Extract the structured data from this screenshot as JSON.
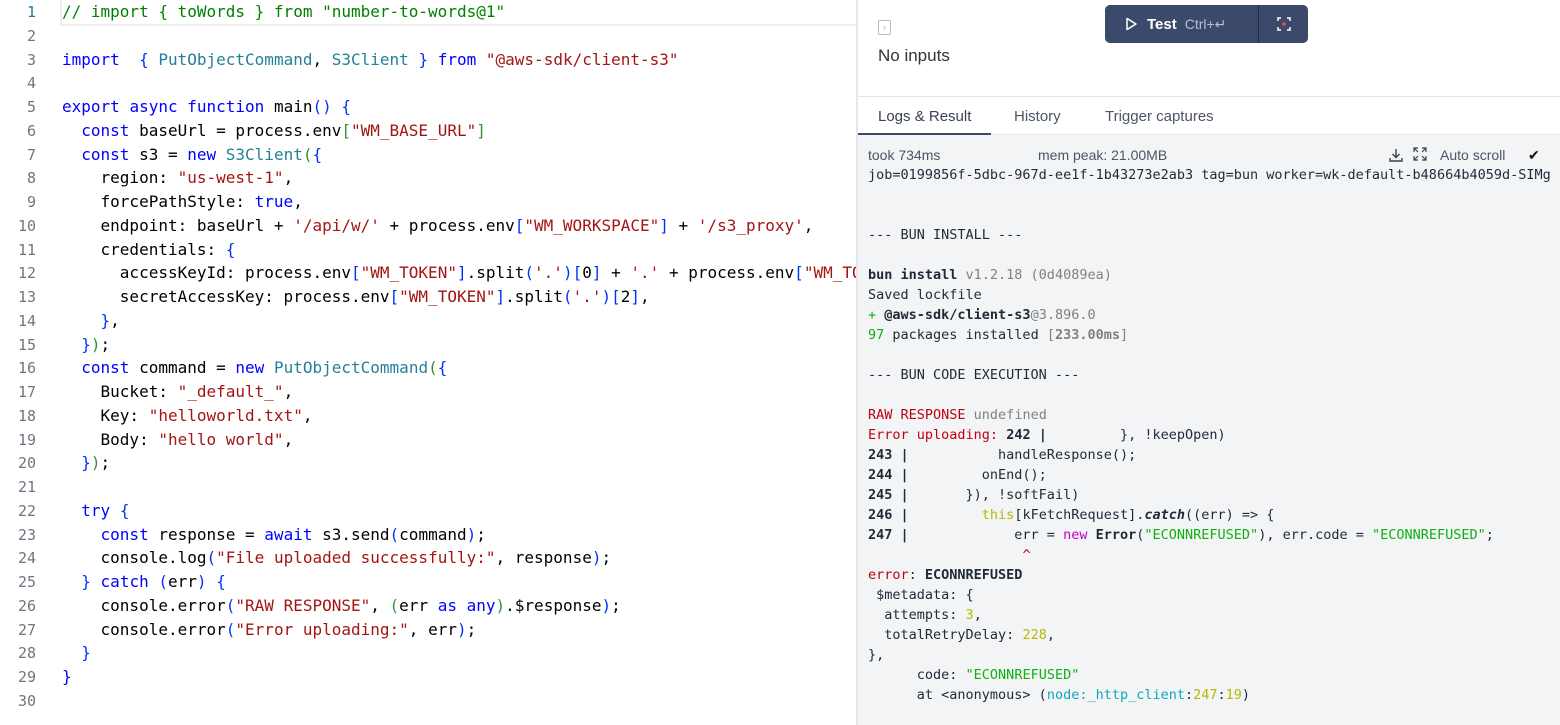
{
  "editor": {
    "lines": [
      [
        [
          "c",
          "// import { toWords } from \"number-to-words@1\""
        ]
      ],
      [],
      [
        [
          "k",
          "import"
        ],
        [
          "",
          "  "
        ],
        [
          "br",
          "{"
        ],
        [
          "",
          " "
        ],
        [
          "t",
          "PutObjectCommand"
        ],
        [
          "",
          ", "
        ],
        [
          "t",
          "S3Client"
        ],
        [
          "",
          " "
        ],
        [
          "br",
          "}"
        ],
        [
          "",
          " "
        ],
        [
          "k",
          "from"
        ],
        [
          "",
          " "
        ],
        [
          "s",
          "\"@aws-sdk/client-s3\""
        ]
      ],
      [],
      [
        [
          "k",
          "export"
        ],
        [
          "",
          " "
        ],
        [
          "k",
          "async"
        ],
        [
          "",
          " "
        ],
        [
          "k",
          "function"
        ],
        [
          "",
          " main"
        ],
        [
          "br",
          "()"
        ],
        [
          "",
          " "
        ],
        [
          "br",
          "{"
        ]
      ],
      [
        [
          "",
          "  "
        ],
        [
          "k",
          "const"
        ],
        [
          "",
          " baseUrl = process.env"
        ],
        [
          "b2",
          "["
        ],
        [
          "s",
          "\"WM_BASE_URL\""
        ],
        [
          "b2",
          "]"
        ]
      ],
      [
        [
          "",
          "  "
        ],
        [
          "k",
          "const"
        ],
        [
          "",
          " s3 = "
        ],
        [
          "k",
          "new"
        ],
        [
          "",
          " "
        ],
        [
          "t",
          "S3Client"
        ],
        [
          "b2",
          "("
        ],
        [
          "br",
          "{"
        ]
      ],
      [
        [
          "",
          "    region: "
        ],
        [
          "s",
          "\"us-west-1\""
        ],
        [
          "",
          ","
        ]
      ],
      [
        [
          "",
          "    forcePathStyle: "
        ],
        [
          "k",
          "true"
        ],
        [
          "",
          ","
        ]
      ],
      [
        [
          "",
          "    endpoint: baseUrl + "
        ],
        [
          "s",
          "'/api/w/'"
        ],
        [
          "",
          " + process.env"
        ],
        [
          "br",
          "["
        ],
        [
          "s",
          "\"WM_WORKSPACE\""
        ],
        [
          "br",
          "]"
        ],
        [
          "",
          " + "
        ],
        [
          "s",
          "'/s3_proxy'"
        ],
        [
          "",
          ","
        ]
      ],
      [
        [
          "",
          "    credentials: "
        ],
        [
          "br",
          "{"
        ]
      ],
      [
        [
          "",
          "      accessKeyId: process.env"
        ],
        [
          "br",
          "["
        ],
        [
          "s",
          "\"WM_TOKEN\""
        ],
        [
          "br",
          "]"
        ],
        [
          "",
          ".split"
        ],
        [
          "br",
          "("
        ],
        [
          "s",
          "'.'"
        ],
        [
          "br",
          ")"
        ],
        [
          "br",
          "["
        ],
        [
          "",
          "0"
        ],
        [
          "br",
          "]"
        ],
        [
          "",
          " + "
        ],
        [
          "s",
          "'.'"
        ],
        [
          "",
          " + process.env"
        ],
        [
          "br",
          "["
        ],
        [
          "s",
          "\"WM_TOKEN\""
        ],
        [
          "br",
          "]"
        ]
      ],
      [
        [
          "",
          "      secretAccessKey: process.env"
        ],
        [
          "br",
          "["
        ],
        [
          "s",
          "\"WM_TOKEN\""
        ],
        [
          "br",
          "]"
        ],
        [
          "",
          ".split"
        ],
        [
          "br",
          "("
        ],
        [
          "s",
          "'.'"
        ],
        [
          "br",
          ")"
        ],
        [
          "br",
          "["
        ],
        [
          "",
          "2"
        ],
        [
          "br",
          "]"
        ],
        [
          "",
          ","
        ]
      ],
      [
        [
          "",
          "    "
        ],
        [
          "br",
          "}"
        ],
        [
          "",
          ","
        ]
      ],
      [
        [
          "",
          "  "
        ],
        [
          "br",
          "}"
        ],
        [
          "b2",
          ")"
        ],
        [
          "",
          ";"
        ]
      ],
      [
        [
          "",
          "  "
        ],
        [
          "k",
          "const"
        ],
        [
          "",
          " command = "
        ],
        [
          "k",
          "new"
        ],
        [
          "",
          " "
        ],
        [
          "t",
          "PutObjectCommand"
        ],
        [
          "b2",
          "("
        ],
        [
          "br",
          "{"
        ]
      ],
      [
        [
          "",
          "    Bucket: "
        ],
        [
          "s",
          "\"_default_\""
        ],
        [
          "",
          ","
        ]
      ],
      [
        [
          "",
          "    Key: "
        ],
        [
          "s",
          "\"helloworld.txt\""
        ],
        [
          "",
          ","
        ]
      ],
      [
        [
          "",
          "    Body: "
        ],
        [
          "s",
          "\"hello world\""
        ],
        [
          "",
          ","
        ]
      ],
      [
        [
          "",
          "  "
        ],
        [
          "br",
          "}"
        ],
        [
          "b2",
          ")"
        ],
        [
          "",
          ";"
        ]
      ],
      [],
      [
        [
          "",
          "  "
        ],
        [
          "k",
          "try"
        ],
        [
          "",
          " "
        ],
        [
          "br",
          "{"
        ]
      ],
      [
        [
          "",
          "    "
        ],
        [
          "k",
          "const"
        ],
        [
          "",
          " response = "
        ],
        [
          "k",
          "await"
        ],
        [
          "",
          " s3.send"
        ],
        [
          "br",
          "("
        ],
        [
          "",
          "command"
        ],
        [
          "br",
          ")"
        ],
        [
          "",
          ";"
        ]
      ],
      [
        [
          "",
          "    console.log"
        ],
        [
          "br",
          "("
        ],
        [
          "s",
          "\"File uploaded successfully:\""
        ],
        [
          "",
          ", response"
        ],
        [
          "br",
          ")"
        ],
        [
          "",
          ";"
        ]
      ],
      [
        [
          "",
          "  "
        ],
        [
          "br",
          "}"
        ],
        [
          "",
          " "
        ],
        [
          "k",
          "catch"
        ],
        [
          "",
          " "
        ],
        [
          "br",
          "("
        ],
        [
          "",
          "err"
        ],
        [
          "br",
          ")"
        ],
        [
          "",
          " "
        ],
        [
          "br",
          "{"
        ]
      ],
      [
        [
          "",
          "    console.error"
        ],
        [
          "br",
          "("
        ],
        [
          "s",
          "\"RAW RESPONSE\""
        ],
        [
          "",
          ", "
        ],
        [
          "b2",
          "("
        ],
        [
          "",
          "err "
        ],
        [
          "k",
          "as"
        ],
        [
          "",
          " "
        ],
        [
          "k",
          "any"
        ],
        [
          "b2",
          ")"
        ],
        [
          "",
          ".$response"
        ],
        [
          "br",
          ")"
        ],
        [
          "",
          ";"
        ]
      ],
      [
        [
          "",
          "    console.error"
        ],
        [
          "br",
          "("
        ],
        [
          "s",
          "\"Error uploading:\""
        ],
        [
          "",
          ", err"
        ],
        [
          "br",
          ")"
        ],
        [
          "",
          ";"
        ]
      ],
      [
        [
          "",
          "  "
        ],
        [
          "br",
          "}"
        ]
      ],
      [
        [
          "k",
          "}"
        ]
      ],
      []
    ]
  },
  "panel": {
    "no_inputs": "No inputs",
    "test_button": {
      "label": "Test",
      "shortcut": "Ctrl+↵"
    },
    "tabs": [
      {
        "label": "Logs & Result",
        "active": true
      },
      {
        "label": "History"
      },
      {
        "label": "Trigger captures"
      }
    ],
    "meta": {
      "took": "took 734ms",
      "mem": "mem peak: 21.00MB",
      "auto_scroll": "Auto scroll",
      "auto_scroll_checked": "✔"
    },
    "log_lines": [
      [
        [
          "",
          "job=0199856f-5dbc-967d-ee1f-1b43273e2ab3 tag=bun worker=wk-default-b48664b4059d-SIMg"
        ]
      ],
      [],
      [],
      [
        [
          "",
          "--- BUN INSTALL ---"
        ]
      ],
      [],
      [
        [
          "bd",
          "bun install"
        ],
        [
          "gr",
          " v1.2.18 (0d4089ea)"
        ]
      ],
      [
        [
          "",
          "Saved lockfile"
        ]
      ],
      [
        [
          "g",
          "+ "
        ],
        [
          "bd",
          "@aws-sdk/client-s3"
        ],
        [
          "gr",
          "@3.896.0"
        ]
      ],
      [
        [
          "g",
          "97"
        ],
        [
          "",
          " packages installed "
        ],
        [
          "gr",
          "["
        ],
        [
          "bd gr",
          "233.00ms"
        ],
        [
          "gr",
          "]"
        ]
      ],
      [],
      [
        [
          "",
          "--- BUN CODE EXECUTION ---"
        ]
      ],
      [],
      [
        [
          "r",
          "RAW RESPONSE"
        ],
        [
          "gr",
          " undefined"
        ]
      ],
      [
        [
          "r",
          "Error uploading"
        ],
        [
          "r",
          ":"
        ],
        [
          "bd",
          " 242 |"
        ],
        [
          "",
          "         }, !keepOpen)"
        ]
      ],
      [
        [
          "bd",
          "243 |"
        ],
        [
          "",
          "           handleResponse();"
        ]
      ],
      [
        [
          "bd",
          "244 |"
        ],
        [
          "",
          "         onEnd();"
        ]
      ],
      [
        [
          "bd",
          "245 |"
        ],
        [
          "",
          "       }), !softFail)"
        ]
      ],
      [
        [
          "bd",
          "246 |"
        ],
        [
          "",
          "         "
        ],
        [
          "y",
          "this"
        ],
        [
          "",
          "[kFetchRequest]."
        ],
        [
          "it",
          "catch"
        ],
        [
          "",
          "((err) => {"
        ]
      ],
      [
        [
          "bd",
          "247 |"
        ],
        [
          "",
          "             err = "
        ],
        [
          "m",
          "new"
        ],
        [
          "",
          " "
        ],
        [
          "bd",
          "Error"
        ],
        [
          "",
          "("
        ],
        [
          "g",
          "\"ECONNREFUSED\""
        ],
        [
          "",
          "), err.code = "
        ],
        [
          "g",
          "\"ECONNREFUSED\""
        ],
        [
          "",
          ";"
        ]
      ],
      [
        [
          "",
          "                   "
        ],
        [
          "r",
          "^"
        ]
      ],
      [
        [
          "r",
          "error"
        ],
        [
          "",
          ": "
        ],
        [
          "bd",
          "ECONNREFUSED"
        ]
      ],
      [
        [
          "",
          " $metadata: {"
        ]
      ],
      [
        [
          "",
          "  attempts: "
        ],
        [
          "y",
          "3"
        ],
        [
          "",
          ","
        ]
      ],
      [
        [
          "",
          "  totalRetryDelay: "
        ],
        [
          "y",
          "228"
        ],
        [
          "",
          ","
        ]
      ],
      [
        [
          "",
          "},"
        ]
      ],
      [
        [
          "",
          "      code: "
        ],
        [
          "g",
          "\"ECONNREFUSED\""
        ]
      ],
      [
        [
          "",
          "      at <anonymous> ("
        ],
        [
          "cy",
          "node:_http_client"
        ],
        [
          "",
          ":"
        ],
        [
          "y",
          "247"
        ],
        [
          "",
          ":"
        ],
        [
          "y",
          "19"
        ],
        [
          "",
          ")"
        ]
      ]
    ]
  }
}
